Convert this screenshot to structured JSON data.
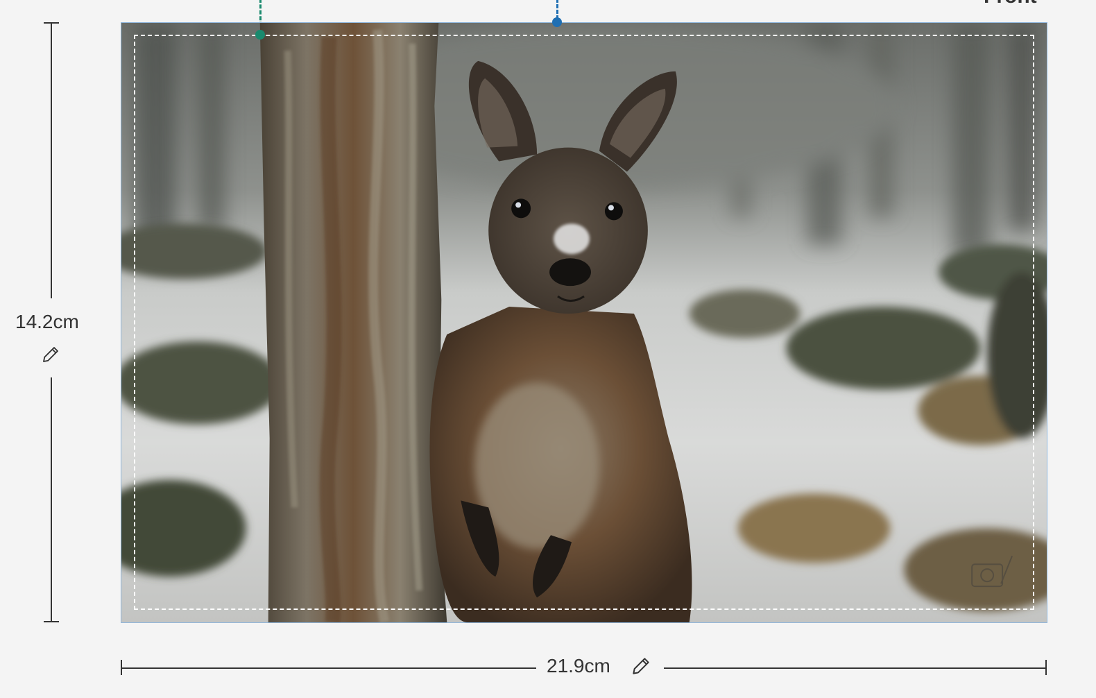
{
  "canvas": {
    "corner_label": "Front"
  },
  "dimensions": {
    "height_value": "14.2cm",
    "width_value": "21.9cm"
  },
  "colors": {
    "background": "#f4f4f4",
    "frame_border": "#8fb6dc",
    "guide_green": "#1a8a6e",
    "guide_blue": "#1f6fb3",
    "safe_area": "#ffffff",
    "ruler": "#333333"
  },
  "icons": {
    "height_edit": "pencil-icon",
    "width_edit": "pencil-icon"
  }
}
